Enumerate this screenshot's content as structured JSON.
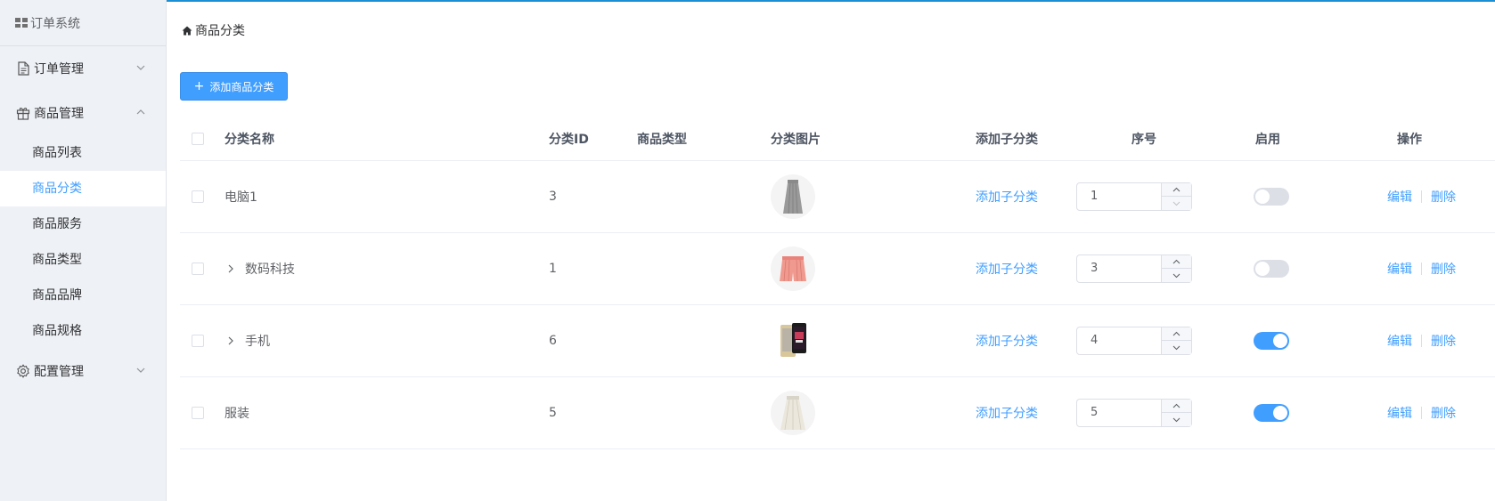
{
  "app": {
    "title": "订单系统"
  },
  "colors": {
    "accent": "#409eff",
    "topline": "#1a8fd6",
    "sidebar_bg": "#eef1f6"
  },
  "sidebar": {
    "groups": [
      {
        "label": "订单管理",
        "icon": "document-icon",
        "expanded": false
      },
      {
        "label": "商品管理",
        "icon": "gift-icon",
        "expanded": true,
        "items": [
          {
            "label": "商品列表",
            "active": false
          },
          {
            "label": "商品分类",
            "active": true
          },
          {
            "label": "商品服务",
            "active": false
          },
          {
            "label": "商品类型",
            "active": false
          },
          {
            "label": "商品品牌",
            "active": false
          },
          {
            "label": "商品规格",
            "active": false
          }
        ]
      },
      {
        "label": "配置管理",
        "icon": "gear-icon",
        "expanded": false
      }
    ]
  },
  "breadcrumb": {
    "icon": "home-icon",
    "label": "商品分类"
  },
  "toolbar": {
    "add_label": "添加商品分类"
  },
  "table": {
    "headers": {
      "name": "分类名称",
      "id": "分类ID",
      "type": "商品类型",
      "image": "分类图片",
      "add_child": "添加子分类",
      "order": "序号",
      "enabled": "启用",
      "actions": "操作"
    },
    "rows": [
      {
        "name": "电脑1",
        "id": "3",
        "type": "",
        "image": "gray-skirt",
        "add_child": "添加子分类",
        "order": "1",
        "enabled": false,
        "expandable": false,
        "edit": "编辑",
        "delete": "删除"
      },
      {
        "name": "数码科技",
        "id": "1",
        "type": "",
        "image": "pink-shorts",
        "add_child": "添加子分类",
        "order": "3",
        "enabled": false,
        "expandable": true,
        "edit": "编辑",
        "delete": "删除"
      },
      {
        "name": "手机",
        "id": "6",
        "type": "",
        "image": "phone",
        "add_child": "添加子分类",
        "order": "4",
        "enabled": true,
        "expandable": true,
        "edit": "编辑",
        "delete": "删除"
      },
      {
        "name": "服装",
        "id": "5",
        "type": "",
        "image": "white-skirt",
        "add_child": "添加子分类",
        "order": "5",
        "enabled": true,
        "expandable": false,
        "edit": "编辑",
        "delete": "删除"
      }
    ]
  }
}
